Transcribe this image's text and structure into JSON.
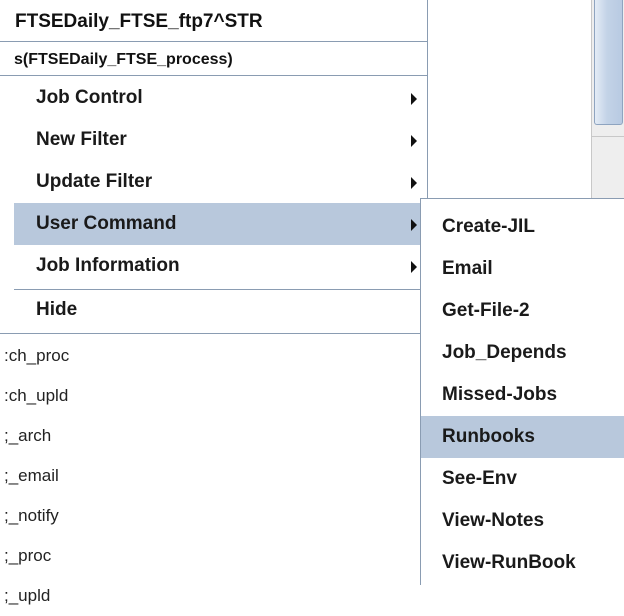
{
  "header": {
    "title": "FTSEDaily_FTSE_ftp7^STR",
    "subtitle": "s(FTSEDaily_FTSE_process)"
  },
  "menu": {
    "items": [
      {
        "label": "Job Control"
      },
      {
        "label": "New Filter"
      },
      {
        "label": "Update Filter"
      },
      {
        "label": "User Command"
      },
      {
        "label": "Job Information"
      }
    ],
    "hide_label": "Hide"
  },
  "submenu": {
    "items": [
      {
        "label": "Create-JIL"
      },
      {
        "label": "Email"
      },
      {
        "label": "Get-File-2"
      },
      {
        "label": "Job_Depends"
      },
      {
        "label": "Missed-Jobs"
      },
      {
        "label": "Runbooks"
      },
      {
        "label": "See-Env"
      },
      {
        "label": "View-Notes"
      },
      {
        "label": "View-RunBook"
      }
    ]
  },
  "background_list": {
    "items": [
      {
        "label": ":ch_proc"
      },
      {
        "label": ":ch_upld"
      },
      {
        "label": ";_arch"
      },
      {
        "label": ";_email"
      },
      {
        "label": ";_notify"
      },
      {
        "label": ";_proc"
      },
      {
        "label": ";_upld"
      }
    ]
  },
  "colors": {
    "selection": "#b8c8dc",
    "border": "#8a9cb2"
  }
}
